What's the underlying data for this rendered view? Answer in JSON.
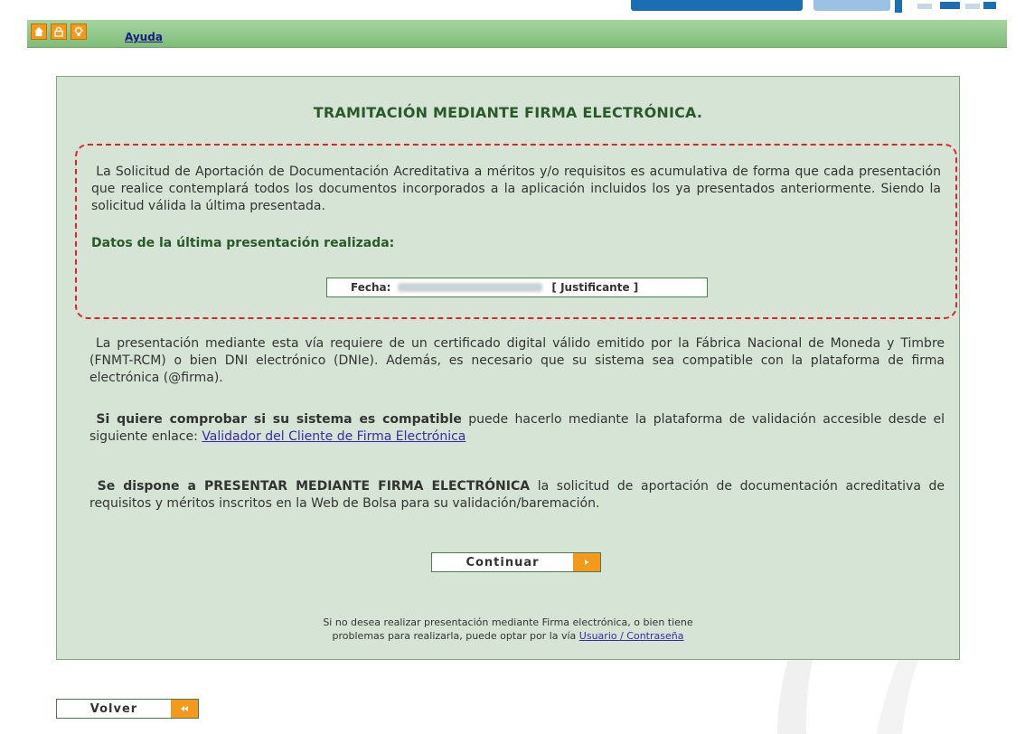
{
  "toolbar": {
    "icons": [
      "home-icon",
      "lock-icon",
      "lightbulb-icon"
    ],
    "help_label": "Ayuda"
  },
  "main": {
    "title": "TRAMITACIÓN MEDIANTE FIRMA ELECTRÓNICA.",
    "intro_text": "La Solicitud de Aportación de Documentación Acreditativa a méritos y/o requisitos es acumulativa de forma que cada presentación que realice contemplará todos los documentos incorporados a la aplicación incluidos los ya presentados anteriormente. Siendo la solicitud válida la última presentada.",
    "last_submission_heading": "Datos de la última presentación realizada:",
    "fecha_label": "Fecha:",
    "justificante_label": "[ Justificante ]",
    "requirements_text": "La presentación mediante esta vía requiere de un certificado digital válido emitido por la Fábrica Nacional de Moneda y Timbre (FNMT-RCM) o bien DNI electrónico (DNIe). Además, es necesario que su sistema sea compatible con la plataforma de firma electrónica (@firma).",
    "compat_bold": "Si quiere comprobar si su sistema es compatible",
    "compat_text": " puede hacerlo mediante la plataforma de validación accesible desde el siguiente enlace: ",
    "compat_link": "Validador del Cliente de Firma Electrónica",
    "submit_bold": "Se dispone a PRESENTAR MEDIANTE FIRMA ELECTRÓNICA",
    "submit_text": " la solicitud de aportación de documentación acreditativa de requisitos y méritos inscritos en la Web de Bolsa para su validación/baremación.",
    "continue_label": "Continuar",
    "footer_line1": "Si no desea realizar presentación mediante Firma electrónica, o bien tiene",
    "footer_line2": "problemas para realizarla, puede optar por la vía ",
    "footer_link": "Usuario / Contraseña"
  },
  "back_label": "Volver",
  "colors": {
    "toolbar_green": "#8cc585",
    "panel_bg": "#d5e4d5",
    "accent_orange": "#f39a1d",
    "dashed_red": "#e5222a",
    "title_green": "#2a5a2a"
  }
}
